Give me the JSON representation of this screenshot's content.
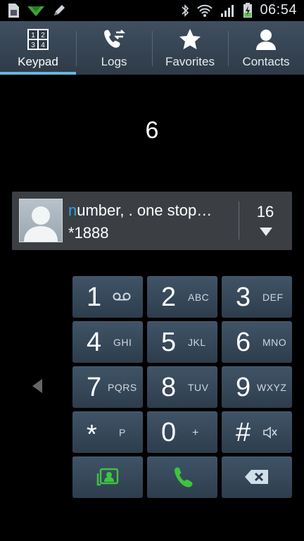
{
  "status_bar": {
    "time": "06:54"
  },
  "tabs": [
    {
      "label": "Keypad",
      "icon": "keypad-icon",
      "active": true
    },
    {
      "label": "Logs",
      "icon": "logs-icon",
      "active": false
    },
    {
      "label": "Favorites",
      "icon": "star-icon",
      "active": false
    },
    {
      "label": "Contacts",
      "icon": "contact-icon",
      "active": false
    }
  ],
  "dialed_number": "6",
  "suggestion": {
    "name_highlight": "n",
    "name_rest": "umber, . one stop…",
    "number": "*1888",
    "count": "16"
  },
  "keys": [
    {
      "digit": "1",
      "letters": ""
    },
    {
      "digit": "2",
      "letters": "ABC"
    },
    {
      "digit": "3",
      "letters": "DEF"
    },
    {
      "digit": "4",
      "letters": "GHI"
    },
    {
      "digit": "5",
      "letters": "JKL"
    },
    {
      "digit": "6",
      "letters": "MNO"
    },
    {
      "digit": "7",
      "letters": "PQRS"
    },
    {
      "digit": "8",
      "letters": "TUV"
    },
    {
      "digit": "9",
      "letters": "WXYZ"
    },
    {
      "digit": "*",
      "letters": "P"
    },
    {
      "digit": "0",
      "letters": "+"
    },
    {
      "digit": "#",
      "letters": ""
    }
  ],
  "colors": {
    "accent": "#69b5dc",
    "call_green": "#3ec43e",
    "highlight_blue": "#2fa3e6"
  }
}
